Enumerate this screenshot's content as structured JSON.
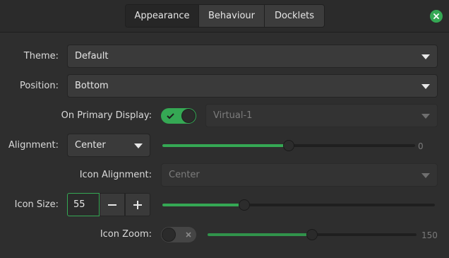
{
  "tabs": [
    {
      "label": "Appearance",
      "active": true
    },
    {
      "label": "Behaviour",
      "active": false
    },
    {
      "label": "Docklets",
      "active": false
    }
  ],
  "theme": {
    "label": "Theme:",
    "value": "Default"
  },
  "position": {
    "label": "Position:",
    "value": "Bottom"
  },
  "primary_display": {
    "label": "On Primary Display:",
    "enabled": true,
    "display_value": "Virtual-1"
  },
  "alignment": {
    "label": "Alignment:",
    "value": "Center",
    "offset_value": "0",
    "offset_fraction": 0.5
  },
  "icon_alignment": {
    "label": "Icon Alignment:",
    "value": "Center"
  },
  "icon_size": {
    "label": "Icon Size:",
    "value": "55",
    "slider_fraction": 0.3
  },
  "icon_zoom": {
    "label": "Icon Zoom:",
    "enabled": false,
    "value": "150",
    "slider_fraction": 0.5
  },
  "colors": {
    "accent": "#35a854",
    "background": "#2e2e2e"
  }
}
